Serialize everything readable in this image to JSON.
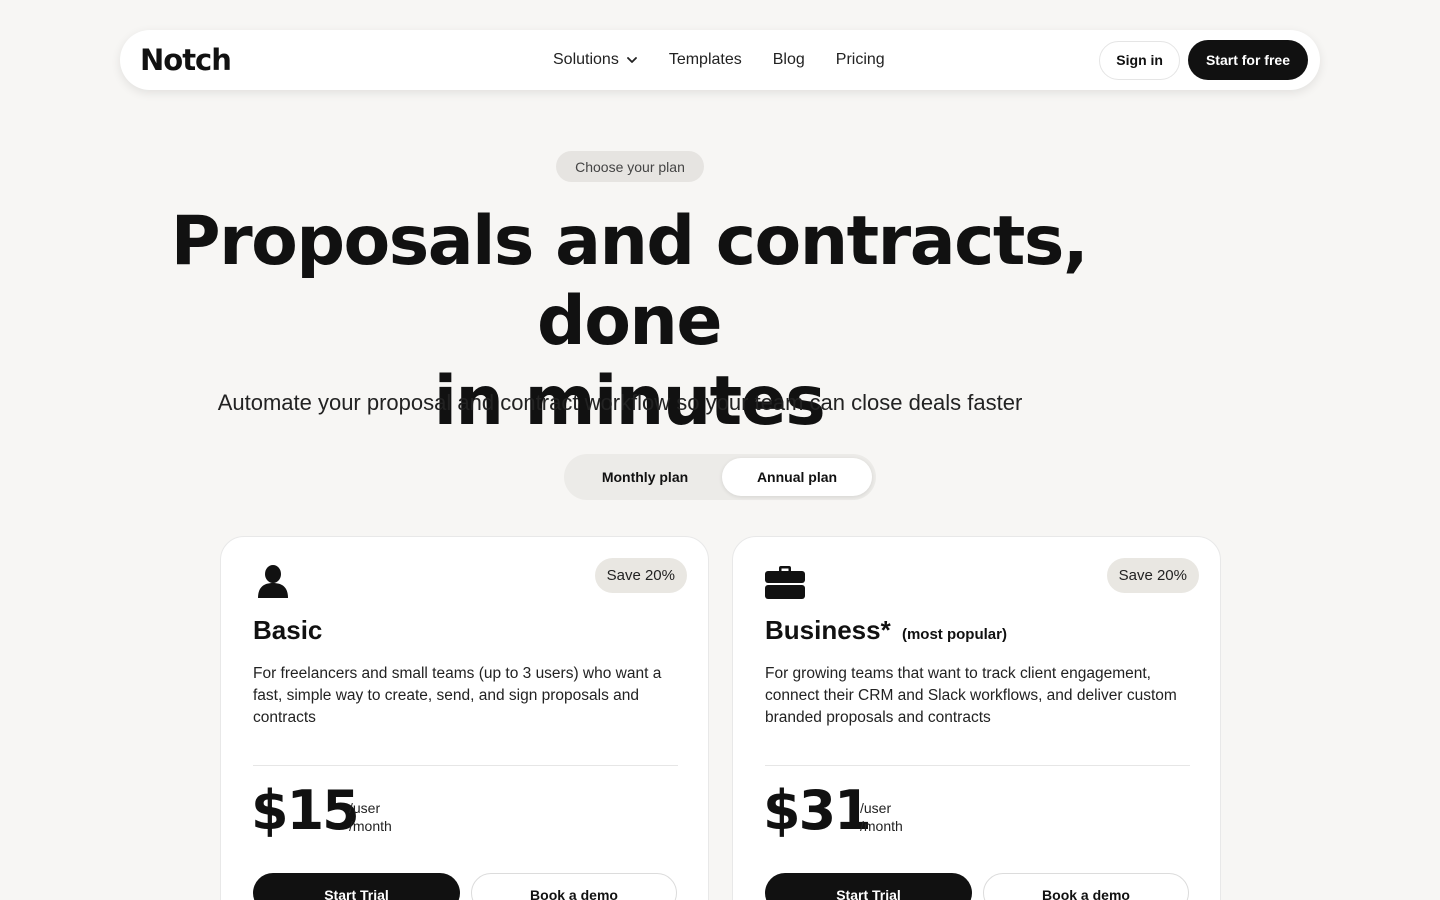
{
  "nav": {
    "logo": "Notch",
    "links": [
      {
        "label": "Solutions"
      },
      {
        "label": "Templates"
      },
      {
        "label": "Blog"
      },
      {
        "label": "Pricing"
      }
    ],
    "sign_in": "Sign in",
    "start_free": "Start for free"
  },
  "hero": {
    "pill": "Choose your plan",
    "title_line1": "Proposals and contracts, done",
    "title_line2": "in minutes",
    "subtitle": "Automate your proposal and contract workflow so your team can close deals faster"
  },
  "toggle": {
    "monthly": "Monthly plan",
    "annual": "Annual plan",
    "selected": "Annual plan"
  },
  "plans": [
    {
      "icon": "person-icon",
      "badge": "Save 20%",
      "name": "Basic",
      "tag": "",
      "description": "For freelancers and small teams (up to 3 users) who want a fast, simple way to create, send, and sign proposals and contracts",
      "price": "$15",
      "unit_user": "/user",
      "unit_month": "/month",
      "cta_primary": "Start Trial",
      "cta_secondary": "Book a demo"
    },
    {
      "icon": "briefcase-icon",
      "badge": "Save 20%",
      "name": "Business*",
      "tag": "(most popular)",
      "description": "For growing teams that want to track client engagement, connect their CRM and Slack workflows, and deliver custom branded proposals and contracts",
      "price": "$31",
      "unit_user": "/user",
      "unit_month": "/month",
      "cta_primary": "Start Trial",
      "cta_secondary": "Book a demo"
    }
  ],
  "colors": {
    "background": "#f7f6f4",
    "primary": "#111111",
    "badge": "#e9e7e2",
    "pill": "#e6e4e1"
  }
}
